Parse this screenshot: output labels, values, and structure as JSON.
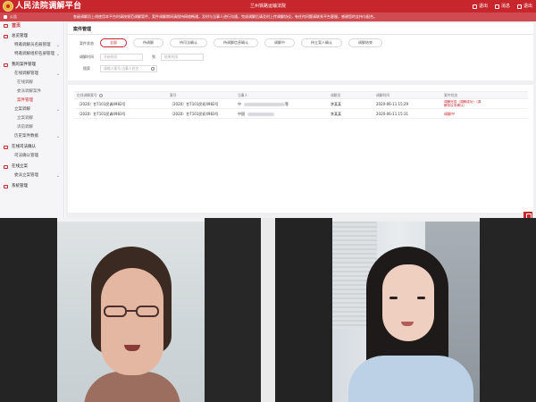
{
  "header": {
    "app_title": "人民法院调解平台",
    "court_name": "兰州铁路运输法院",
    "actions": [
      "退出",
      "消息",
      "退出"
    ]
  },
  "notice": {
    "label": "公告",
    "text": "各级调解员上线使用本平台时请按规范调解案件，案件调解期间请保持网络畅通，及时与当事人进行沟通，完成调解后请及时上传调解协议，有任何问题请联系平台客服，感谢您的支持与配合。"
  },
  "sidebar": {
    "home": "首页",
    "items": [
      {
        "label": "总览管理",
        "type": "group"
      },
      {
        "label": "特邀调解员名册管理",
        "type": "sub"
      },
      {
        "label": "特邀调解组织名册管理",
        "type": "sub"
      },
      {
        "label": "我的案件管理",
        "type": "group"
      },
      {
        "label": "在线调解管理",
        "type": "sub"
      },
      {
        "label": "在线调解",
        "type": "sub2"
      },
      {
        "label": "委派调解案件",
        "type": "sub2"
      },
      {
        "label": "案件管理",
        "type": "sub2",
        "active": true
      },
      {
        "label": "立案调解",
        "type": "sub"
      },
      {
        "label": "立案调解",
        "type": "sub2"
      },
      {
        "label": "诉前调解",
        "type": "sub2"
      },
      {
        "label": "历史案件数据",
        "type": "sub"
      },
      {
        "label": "在线司法确认",
        "type": "group"
      },
      {
        "label": "司法确认管理",
        "type": "sub"
      },
      {
        "label": "在线立案",
        "type": "group"
      },
      {
        "label": "委派立案管理",
        "type": "sub"
      },
      {
        "label": "系统管理",
        "type": "group"
      }
    ]
  },
  "main": {
    "panel_title": "案件管理",
    "status_label": "案件状态",
    "filters": [
      "全部",
      "待调解",
      "待司法确认",
      "待调解信息确认",
      "调解中",
      "待立案人确认",
      "调解结束"
    ],
    "date_label": "调解时间",
    "date_start_placeholder": "开始时间",
    "date_to": "到",
    "date_end_placeholder": "结束时间",
    "search_label": "搜索",
    "search_placeholder": "请输入案号/当事人姓名",
    "table": {
      "headers": [
        "在线调解案号",
        "案号",
        "当事人",
        "调解员",
        "调解时间",
        "案件状态"
      ],
      "rows": [
        {
          "case_no": "（2020）甘7101民调4982号",
          "court_no": "（2020）甘7101民初4982号",
          "party": "中",
          "party_suffix": "等",
          "mediator": "李某某",
          "time": "2020-06-11 15:29",
          "status_line1": "调解完成（调解成功）（调",
          "status_line2": "解协议未确认）"
        },
        {
          "case_no": "（2020）甘7101民调4983号",
          "court_no": "（2020）甘7101民初4983号",
          "party": "中国",
          "party_suffix": "",
          "mediator": "李某某",
          "time": "2020-06-11 15:31",
          "status_line1": "调解中",
          "status_line2": ""
        }
      ]
    }
  },
  "colors": {
    "brand_red": "#c8262d",
    "notice_red": "#cf4b51",
    "sidebar_bg": "#f5f5f7"
  }
}
